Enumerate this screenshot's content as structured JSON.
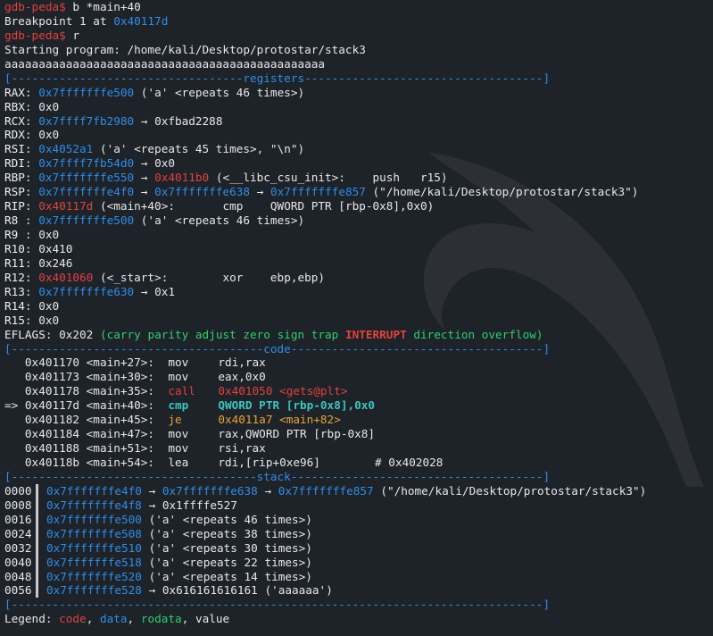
{
  "prompt": "gdb-peda$",
  "cmd1": "b *main+40",
  "bp_prefix": "Breakpoint 1 at ",
  "bp_addr": "0x40117d",
  "cmd2": "r",
  "start_msg": "Starting program: /home/kali/Desktop/protostar/stack3",
  "input_line": "aaaaaaaaaaaaaaaaaaaaaaaaaaaaaaaaaaaaaaaaaaaaaaa",
  "sep_registers": "[----------------------------------registers-----------------------------------]",
  "registers": [
    {
      "name": "RAX",
      "addr": "0x7fffffffe500",
      "rest": " ('a' <repeats 46 times>)"
    },
    {
      "name": "RBX",
      "val": "0x0"
    },
    {
      "name": "RCX",
      "addr": "0x7ffff7fb2980",
      "rest": " → 0xfbad2288"
    },
    {
      "name": "RDX",
      "val": "0x0"
    },
    {
      "name": "RSI",
      "addr": "0x4052a1",
      "rest": " ('a' <repeats 45 times>, \"\\n\")"
    },
    {
      "name": "RDI",
      "addr": "0x7ffff7fb54d0",
      "rest": " → 0x0"
    },
    {
      "name": "RBP",
      "addr": "0x7fffffffe550",
      "arrow": " → ",
      "addr2": "0x4011b0",
      "rest": " (<__libc_csu_init>:    push   r15)"
    },
    {
      "name": "RSP",
      "addr": "0x7fffffffe4f0",
      "arrow": " → ",
      "addr2": "0x7fffffffe638",
      "arrow2": " → ",
      "addr3": "0x7fffffffe857",
      "rest": " (\"/home/kali/Desktop/protostar/stack3\")"
    },
    {
      "name": "RIP",
      "addr": "0x40117d",
      "rest": " (<main+40>:       cmp    QWORD PTR [rbp-0x8],0x0)"
    },
    {
      "name": "R8 ",
      "addr": "0x7fffffffe500",
      "rest": " ('a' <repeats 46 times>)"
    },
    {
      "name": "R9 ",
      "val": "0x0"
    },
    {
      "name": "R10",
      "val": "0x410"
    },
    {
      "name": "R11",
      "val": "0x246"
    },
    {
      "name": "R12",
      "addr": "0x401060",
      "rest": " (<_start>:        xor    ebp,ebp)"
    },
    {
      "name": "R13",
      "addr": "0x7fffffffe630",
      "rest": " → 0x1"
    },
    {
      "name": "R14",
      "val": "0x0"
    },
    {
      "name": "R15",
      "val": "0x0"
    }
  ],
  "eflags": {
    "label": "EFLAGS",
    "value": "0x202",
    "flags_pre": "(carry parity adjust zero sign trap ",
    "flags_hi": "INTERRUPT",
    "flags_post": " direction overflow)"
  },
  "sep_code": "[-------------------------------------code-------------------------------------]",
  "code": [
    {
      "marker": "   ",
      "addr": "0x401170",
      "sym": "<main+27>:",
      "op": "mov",
      "args": "rdi,rax",
      "kind": "normal"
    },
    {
      "marker": "   ",
      "addr": "0x401173",
      "sym": "<main+30>:",
      "op": "mov",
      "args": "eax,0x0",
      "kind": "normal"
    },
    {
      "marker": "   ",
      "addr": "0x401178",
      "sym": "<main+35>:",
      "op": "call",
      "args": "0x401050 <gets@plt>",
      "kind": "call"
    },
    {
      "marker": "=> ",
      "addr": "0x40117d",
      "sym": "<main+40>:",
      "op": "cmp",
      "args": "QWORD PTR [rbp-0x8],0x0",
      "kind": "current"
    },
    {
      "marker": "   ",
      "addr": "0x401182",
      "sym": "<main+45>:",
      "op": "je",
      "args": "0x4011a7 <main+82>",
      "kind": "jump"
    },
    {
      "marker": "   ",
      "addr": "0x401184",
      "sym": "<main+47>:",
      "op": "mov",
      "args": "rax,QWORD PTR [rbp-0x8]",
      "kind": "normal"
    },
    {
      "marker": "   ",
      "addr": "0x401188",
      "sym": "<main+51>:",
      "op": "mov",
      "args": "rsi,rax",
      "kind": "normal"
    },
    {
      "marker": "   ",
      "addr": "0x40118b",
      "sym": "<main+54>:",
      "op": "lea",
      "args": "rdi,[rip+0xe96]        # 0x402028",
      "kind": "normal"
    }
  ],
  "sep_stack": "[------------------------------------stack-------------------------------------]",
  "stack": [
    {
      "off": "0000",
      "addr": "0x7fffffffe4f0",
      "rest": " → ",
      "addr2": "0x7fffffffe638",
      "rest2": " → ",
      "addr3": "0x7fffffffe857",
      "rest3": " (\"/home/kali/Desktop/protostar/stack3\")"
    },
    {
      "off": "0008",
      "addr": "0x7fffffffe4f8",
      "rest": " → 0x1ffffe527"
    },
    {
      "off": "0016",
      "addr": "0x7fffffffe500",
      "rest": " ('a' <repeats 46 times>)"
    },
    {
      "off": "0024",
      "addr": "0x7fffffffe508",
      "rest": " ('a' <repeats 38 times>)"
    },
    {
      "off": "0032",
      "addr": "0x7fffffffe510",
      "rest": " ('a' <repeats 30 times>)"
    },
    {
      "off": "0040",
      "addr": "0x7fffffffe518",
      "rest": " ('a' <repeats 22 times>)"
    },
    {
      "off": "0048",
      "addr": "0x7fffffffe520",
      "rest": " ('a' <repeats 14 times>)"
    },
    {
      "off": "0056",
      "addr": "0x7fffffffe528",
      "rest": " → 0x616161616161 ('aaaaaa')"
    }
  ],
  "sep_end": "[------------------------------------------------------------------------------]",
  "legend": {
    "label": "Legend:",
    "code": "code",
    "data": "data",
    "rodata": "rodata",
    "value": "value"
  },
  "colors": {
    "prompt": "#e0433e",
    "addr": "#2f8ee6",
    "code": "#e0433e",
    "jump": "#e6a43a",
    "current": "#3cc6c1",
    "flags": "#2fd06f",
    "separator": "#2f8ee6"
  }
}
